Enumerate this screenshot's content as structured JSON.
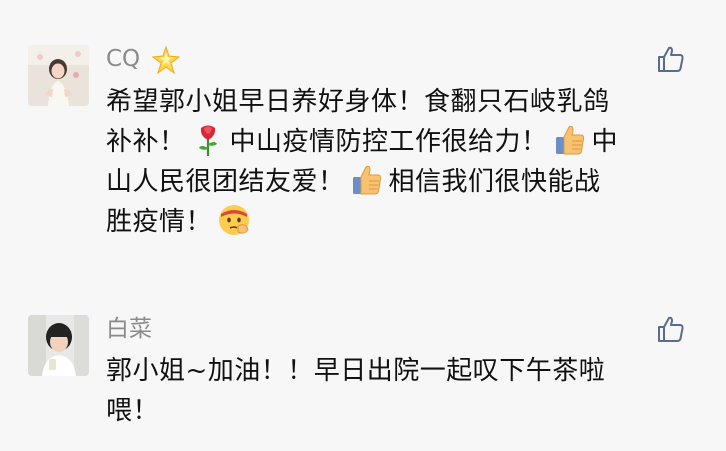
{
  "comments": [
    {
      "author": "CQ",
      "author_badge": "sparkle-star-emoji",
      "like_icon": "thumbs-up-outline-icon",
      "lines": [
        {
          "parts": [
            "希望郭小姐早日养好身体！食翻只石岐乳鸽"
          ]
        },
        {
          "parts": [
            "补补！",
            "[rose]",
            "中山疫情防控工作很给力！",
            "[thumbsup]",
            "中"
          ]
        },
        {
          "parts": [
            "山人民很团结友爱！",
            "[thumbsup]",
            "相信我们很快能战"
          ]
        },
        {
          "parts": [
            "胜疫情！",
            "[salute-face]"
          ]
        }
      ],
      "text_segments": {
        "l1": "希望郭小姐早日养好身体！食翻只石岐乳鸽",
        "l2a": "补补！",
        "l2b": "中山疫情防控工作很给力！",
        "l2c": "中",
        "l3a": "山人民很团结友爱！",
        "l3b": "相信我们很快能战",
        "l4a": "胜疫情！"
      }
    },
    {
      "author": "白菜",
      "like_icon": "thumbs-up-outline-icon",
      "text_segments": {
        "l1": "郭小姐~加油！！早日出院一起叹下午茶啦",
        "l2": "喂！"
      }
    }
  ],
  "colors": {
    "background": "#f7f7f7",
    "author": "#8a8a8a",
    "text": "#111111",
    "like_outline": "#5b6b8c"
  }
}
